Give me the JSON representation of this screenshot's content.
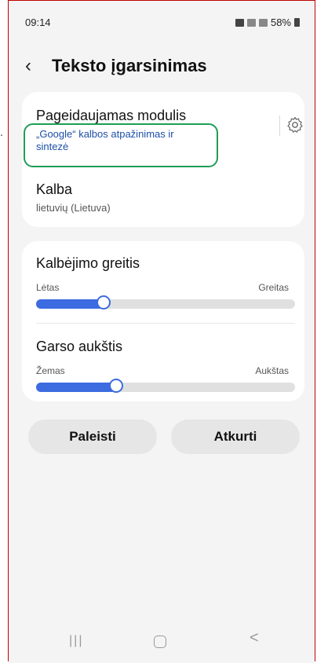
{
  "status_bar": {
    "time": "09:14",
    "battery": "58%"
  },
  "header": {
    "back_icon": "‹",
    "title": "Teksto įgarsinimas"
  },
  "engine": {
    "title": "Pageidaujamas modulis",
    "value": "„Google“ kalbos atpažinimas ir sintezė",
    "settings_icon": "gear-icon"
  },
  "language": {
    "title": "Kalba",
    "value": "lietuvių (Lietuva)"
  },
  "speech_rate": {
    "title": "Kalbėjimo greitis",
    "min_label": "Lėtas",
    "max_label": "Greitas",
    "level": 0.26
  },
  "pitch": {
    "title": "Garso aukštis",
    "min_label": "Žemas",
    "max_label": "Aukštas",
    "level": 0.31
  },
  "buttons": {
    "play": "Paleisti",
    "replay": "Atkurti"
  },
  "nav_bar": {
    "recents": "|||",
    "back": "<"
  },
  "colors": {
    "accent": "#3d6be0",
    "highlight_border": "#1f9d55",
    "frame_border": "#c00000"
  }
}
